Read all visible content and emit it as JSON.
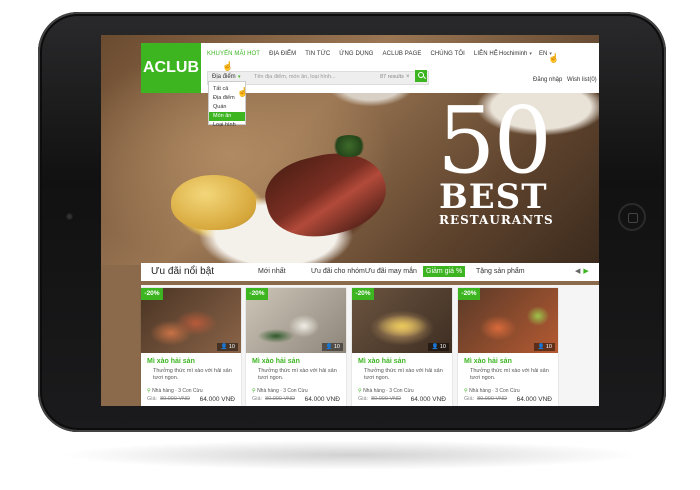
{
  "brand": {
    "logo": "ACLUB",
    "accent_color": "#3cb521"
  },
  "nav": {
    "items": [
      "KHUYẾN MÃI HOT",
      "ĐỊA ĐIỂM",
      "TIN TỨC",
      "ỨNG DỤNG",
      "ACLUB PAGE",
      "CHÚNG TÔI",
      "LIÊN HỆ"
    ],
    "active": "KHUYẾN MÃI HOT"
  },
  "header": {
    "city": "Hochiminh",
    "language": "EN",
    "login": "Đăng nhập",
    "wishlist": "Wish list(0)"
  },
  "search": {
    "category": "Địa điểm",
    "placeholder": "Tên địa điểm, món ăn, loại hình...",
    "results": "87 results",
    "clear": "×"
  },
  "dropdown": {
    "options": [
      "Tất cả",
      "Địa điểm",
      "Quán",
      "Món ăn",
      "Loại hình"
    ],
    "selected": "Món ăn"
  },
  "hero": {
    "number": "50",
    "word": "BEST",
    "subword": "RESTAURANTS"
  },
  "offers": {
    "title": "Ưu đãi nổi bật",
    "tabs": [
      "Mới nhất",
      "Ưu đãi cho nhóm",
      "Ưu đãi may mắn",
      "Giảm giá %",
      "Tặng sản phẩm"
    ],
    "active_tab": "Giảm giá %"
  },
  "cards": [
    {
      "discount": "-20%",
      "count": "10",
      "title": "Mì xào hải sản",
      "description": "Thưởng thức mì xào với hải sản tươi ngon.",
      "category": "Nhà hàng",
      "location": "3 Con Cừu",
      "old_label": "Giá:",
      "old_price": "80.000 VNĐ",
      "new_price": "64.000 VNĐ"
    },
    {
      "discount": "-20%",
      "count": "10",
      "title": "Mì xào hải sản",
      "description": "Thưởng thức mì xào với hải sản tươi ngon.",
      "category": "Nhà hàng",
      "location": "3 Con Cừu",
      "old_label": "Giá:",
      "old_price": "80.000 VNĐ",
      "new_price": "64.000 VNĐ"
    },
    {
      "discount": "-20%",
      "count": "10",
      "title": "Mì xào hải sản",
      "description": "Thưởng thức mì xào với hải sản tươi ngon.",
      "category": "Nhà hàng",
      "location": "3 Con Cừu",
      "old_label": "Giá:",
      "old_price": "80.000 VNĐ",
      "new_price": "64.000 VNĐ"
    },
    {
      "discount": "-20%",
      "count": "10",
      "title": "Mì xào hải sản",
      "description": "Thưởng thức mì xào với hải sản tươi ngon.",
      "category": "Nhà hàng",
      "location": "3 Con Cừu",
      "old_label": "Giá:",
      "old_price": "80.000 VNĐ",
      "new_price": "64.000 VNĐ"
    }
  ]
}
